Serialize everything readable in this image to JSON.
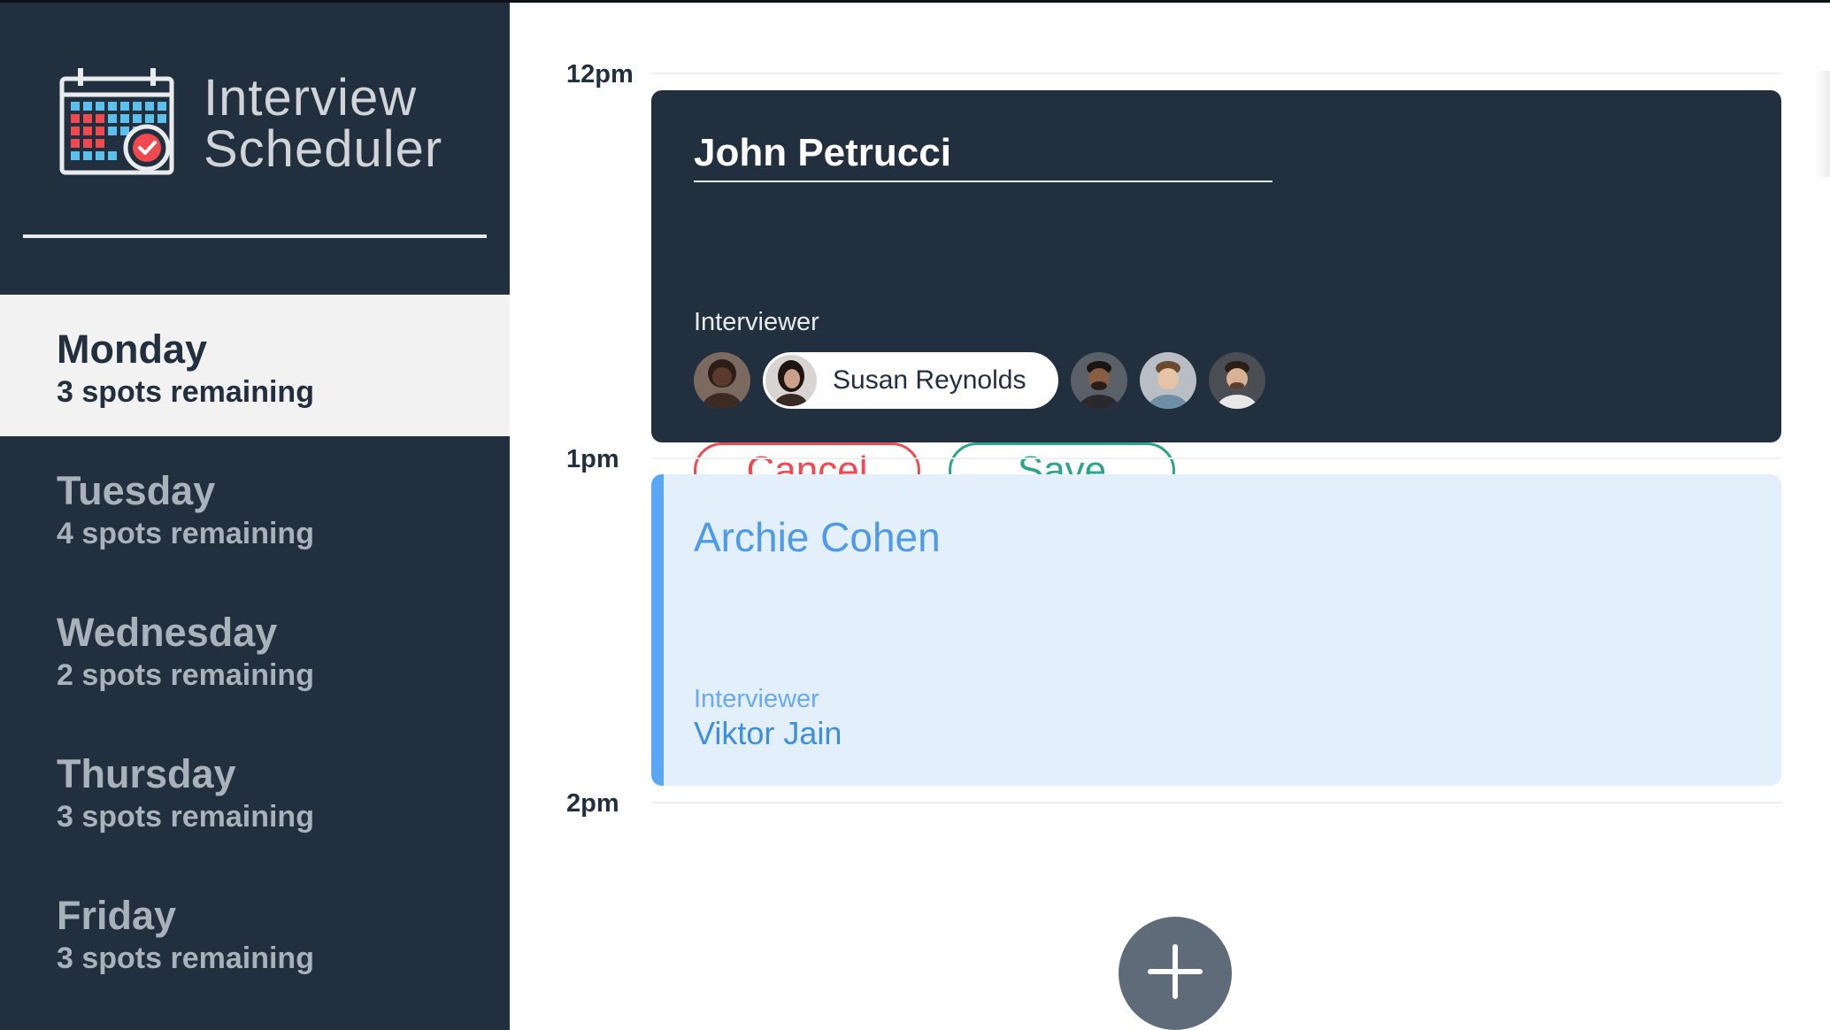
{
  "app": {
    "title_line1": "Interview",
    "title_line2": "Scheduler"
  },
  "days": [
    {
      "name": "Monday",
      "spots": "3 spots remaining",
      "selected": true
    },
    {
      "name": "Tuesday",
      "spots": "4 spots remaining",
      "selected": false
    },
    {
      "name": "Wednesday",
      "spots": "2 spots remaining",
      "selected": false
    },
    {
      "name": "Thursday",
      "spots": "3 spots remaining",
      "selected": false
    },
    {
      "name": "Friday",
      "spots": "3 spots remaining",
      "selected": false
    }
  ],
  "times": [
    "12pm",
    "1pm",
    "2pm"
  ],
  "form": {
    "student_value": "John Petrucci",
    "interviewer_label": "Interviewer",
    "selected_interviewer": "Susan Reynolds",
    "cancel_label": "Cancel",
    "save_label": "Save"
  },
  "appointment": {
    "student": "Archie Cohen",
    "interviewer_label": "Interviewer",
    "interviewer": "Viktor Jain"
  },
  "colors": {
    "sidebar_bg": "#222f3e",
    "danger": "#f0494f",
    "success": "#2aa58b",
    "appointment_accent": "#5aa8f5"
  },
  "icons": {
    "logo": "calendar-check-icon",
    "add": "plus-icon"
  }
}
